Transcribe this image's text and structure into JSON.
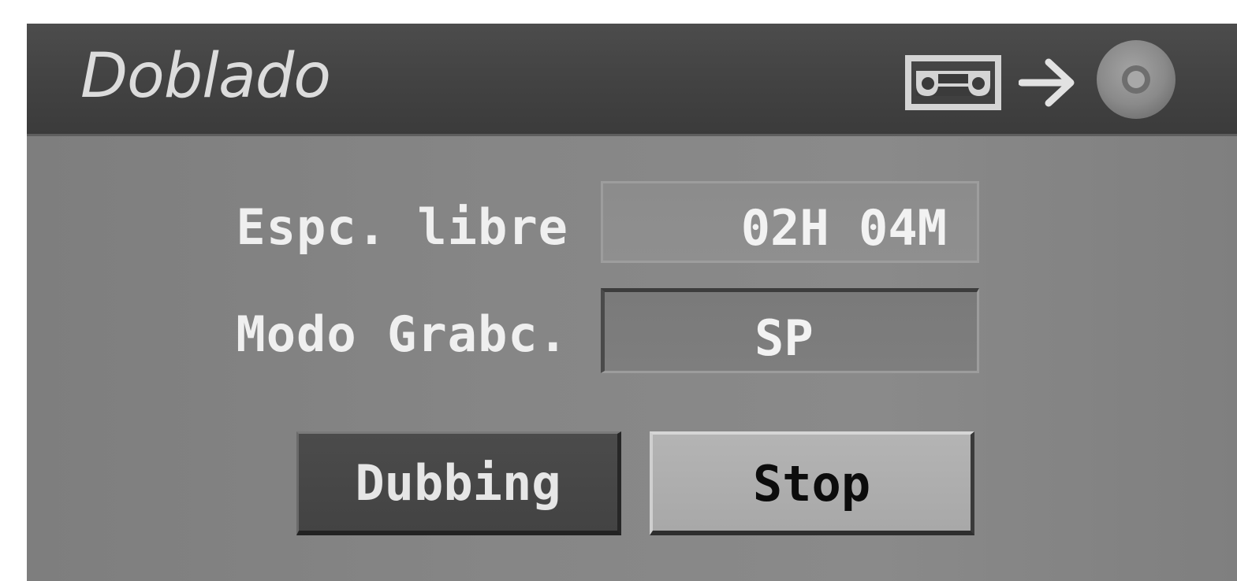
{
  "dialog": {
    "title": "Doblado",
    "direction_icons": [
      "vcr-tape-icon",
      "arrow-right-icon",
      "dvd-disc-icon"
    ]
  },
  "fields": {
    "free_space": {
      "label": "Espc. libre",
      "value": "02H 04M"
    },
    "record_mode": {
      "label": "Modo Grabc.",
      "value": "SP"
    }
  },
  "buttons": {
    "dubbing_label": "Dubbing",
    "stop_label": "Stop",
    "focused": "Stop"
  },
  "colors": {
    "titlebar": "#444444",
    "panel": "#858585",
    "highlight_button": "#aeaeae",
    "button_dark": "#474747"
  }
}
